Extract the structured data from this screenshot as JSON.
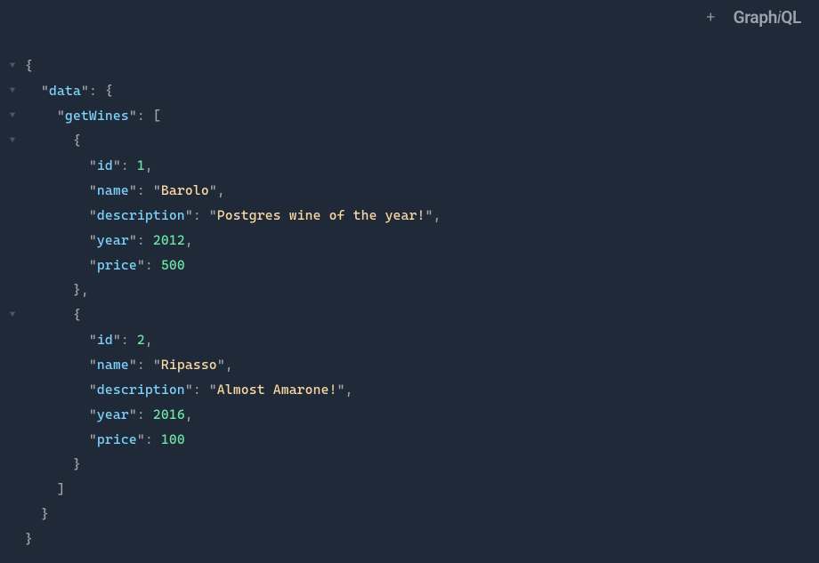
{
  "header": {
    "plus_label": "+",
    "logo_part1": "Graph",
    "logo_italic": "i",
    "logo_part3": "QL"
  },
  "arrows": {
    "collapsed": "▶",
    "expanded": "▼"
  },
  "json": {
    "brace_open": "{",
    "brace_close": "}",
    "bracket_open": "[",
    "bracket_close": "]",
    "comma": ",",
    "colon": ": ",
    "quote": "\"",
    "keys": {
      "data": "data",
      "getWines": "getWines",
      "id": "id",
      "name": "name",
      "description": "description",
      "year": "year",
      "price": "price"
    },
    "wines": [
      {
        "id": "1",
        "name": "Barolo",
        "description": "Postgres wine of the year!",
        "year": "2012",
        "price": "500"
      },
      {
        "id": "2",
        "name": "Ripasso",
        "description": "Almost Amarone!",
        "year": "2016",
        "price": "100"
      }
    ]
  }
}
